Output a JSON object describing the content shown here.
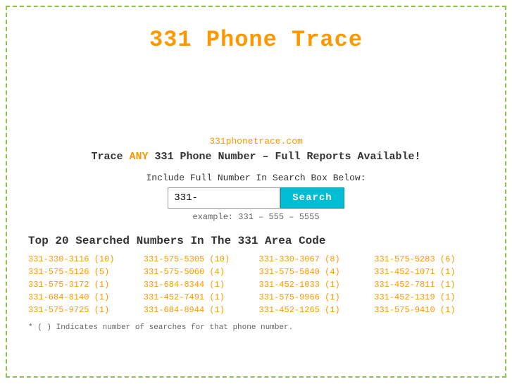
{
  "page": {
    "title": "331 Phone Trace",
    "site_url": "331phonetrace.com",
    "tagline_prefix": "Trace ",
    "tagline_any": "ANY",
    "tagline_suffix": " 331 Phone Number – Full Reports Available!",
    "search_label": "Include Full Number In Search Box Below:",
    "search_placeholder": "331-",
    "search_value": "331-",
    "search_button_label": "Search",
    "search_example": "example: 331 – 555 – 5555",
    "top_numbers_title": "Top 20 Searched Numbers In The 331 Area Code",
    "footnote": "* ( ) Indicates number of searches for that phone number."
  },
  "numbers": [
    {
      "display": "331-330-3116 (10)",
      "href": "#"
    },
    {
      "display": "331-575-5305 (10)",
      "href": "#"
    },
    {
      "display": "331-330-3067 (8)",
      "href": "#"
    },
    {
      "display": "331-575-5283 (6)",
      "href": "#"
    },
    {
      "display": "331-575-5126 (5)",
      "href": "#"
    },
    {
      "display": "331-575-5060 (4)",
      "href": "#"
    },
    {
      "display": "331-575-5840 (4)",
      "href": "#"
    },
    {
      "display": "331-452-1071 (1)",
      "href": "#"
    },
    {
      "display": "331-575-3172 (1)",
      "href": "#"
    },
    {
      "display": "331-684-8344 (1)",
      "href": "#"
    },
    {
      "display": "331-452-1033 (1)",
      "href": "#"
    },
    {
      "display": "331-452-7811 (1)",
      "href": "#"
    },
    {
      "display": "331-684-8140 (1)",
      "href": "#"
    },
    {
      "display": "331-452-7491 (1)",
      "href": "#"
    },
    {
      "display": "331-575-9966 (1)",
      "href": "#"
    },
    {
      "display": "331-452-1319 (1)",
      "href": "#"
    },
    {
      "display": "331-575-9725 (1)",
      "href": "#"
    },
    {
      "display": "331-684-8944 (1)",
      "href": "#"
    },
    {
      "display": "331-452-1265 (1)",
      "href": "#"
    },
    {
      "display": "331-575-9410 (1)",
      "href": "#"
    }
  ]
}
